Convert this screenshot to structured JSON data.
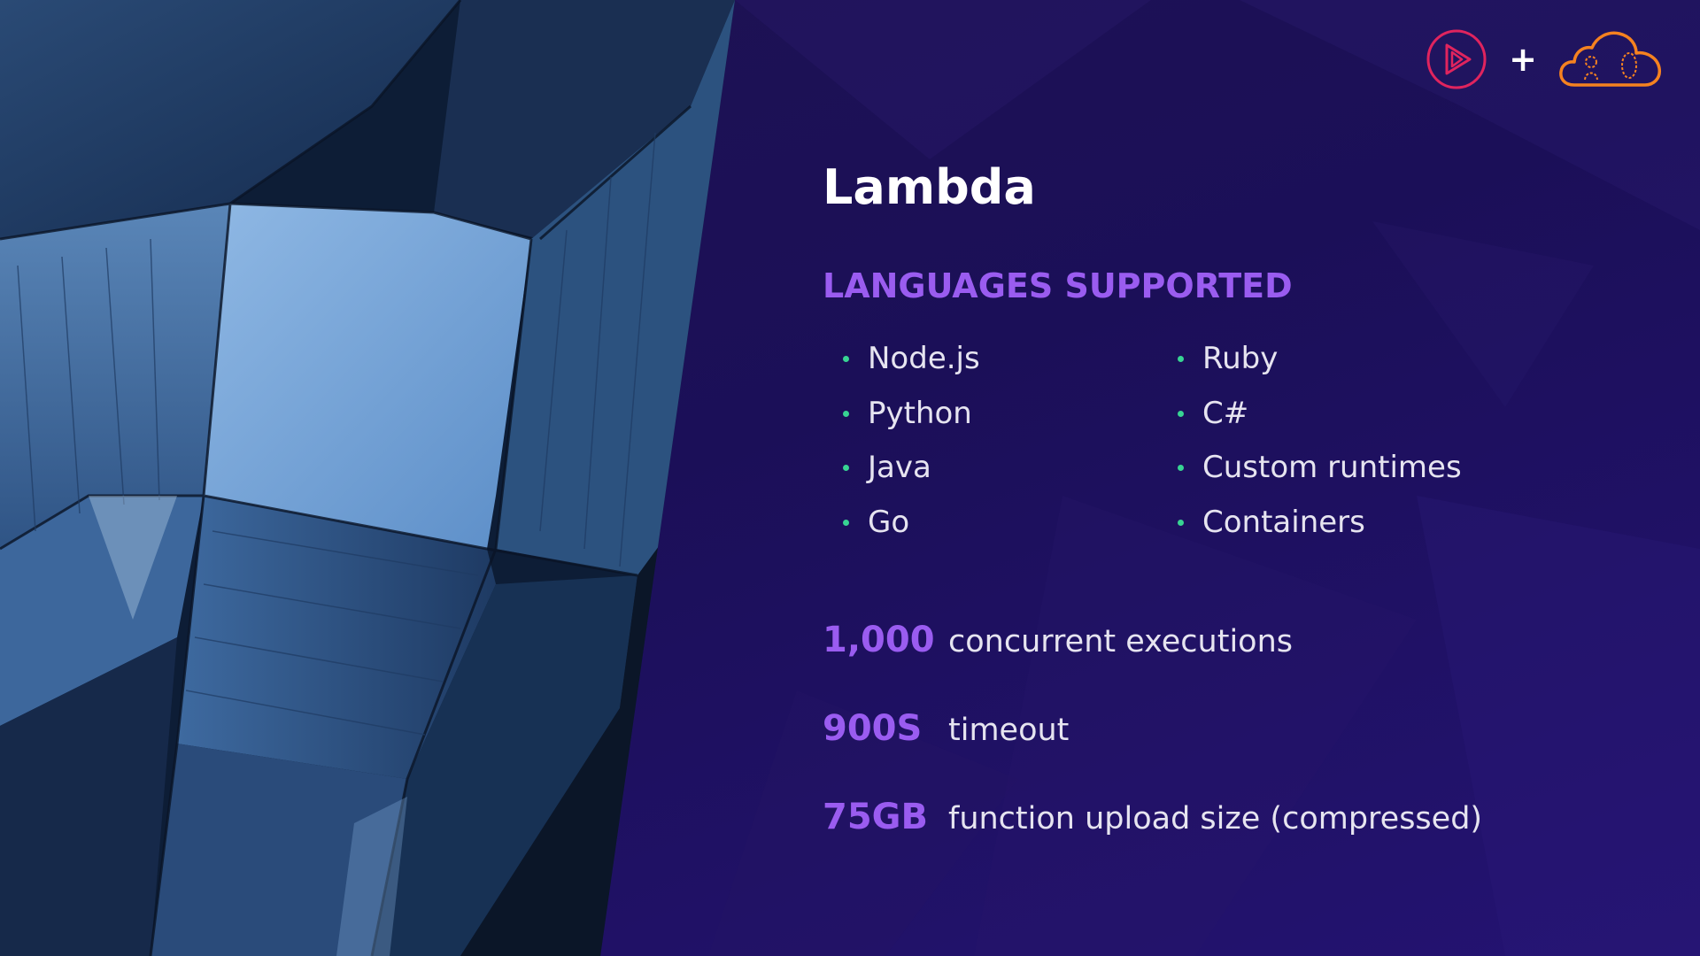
{
  "slide": {
    "title": "Lambda",
    "subtitle": "LANGUAGES SUPPORTED",
    "languages_left": [
      "Node.js",
      "Python",
      "Java",
      "Go"
    ],
    "languages_right": [
      "Ruby",
      "C#",
      "Custom runtimes",
      "Containers"
    ],
    "stats": [
      {
        "value": "1,000",
        "label": "concurrent executions"
      },
      {
        "value": "900S",
        "label": "timeout"
      },
      {
        "value": "75GB",
        "label": "function upload size (compressed)"
      }
    ],
    "plus_sign": "+"
  },
  "icons": {
    "left_logo": "pluralsight-play-icon",
    "right_logo": "acloudguru-cloud-icon"
  },
  "colors": {
    "background": "#1b0f58",
    "accent_purple": "#9a5cf0",
    "bullet_green": "#38d493",
    "text": "#e6e4f0",
    "pluralsight_red": "#e0245e",
    "acg_orange": "#f58220"
  }
}
